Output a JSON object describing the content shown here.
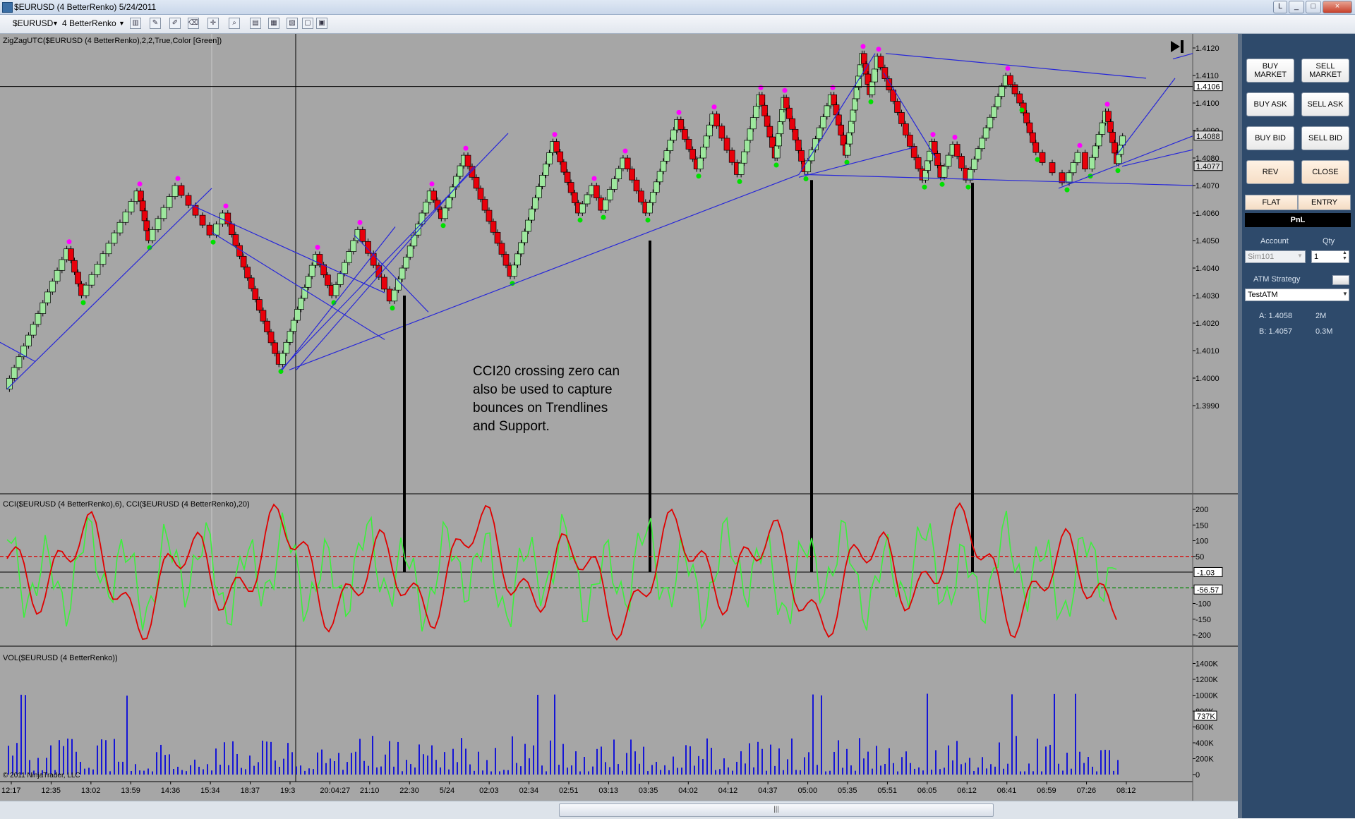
{
  "window": {
    "title": "$EURUSD (4 BetterRenko)  5/24/2011",
    "buttons": [
      "L",
      "_",
      "□",
      "×"
    ]
  },
  "toolbar": {
    "instrument": "$EURUSD",
    "period": "4 BetterRenko"
  },
  "main_panel": {
    "indicator_label": "ZigZagUTC($EURUSD (4 BetterRenko),2,2,True,Color [Green])",
    "y_ticks": [
      "1.4120",
      "1.4110",
      "1.4100",
      "1.4090",
      "1.4080",
      "1.4070",
      "1.4060",
      "1.4050",
      "1.4040",
      "1.4030",
      "1.4020",
      "1.4010",
      "1.4000",
      "1.3990"
    ],
    "price_markers": [
      {
        "text": "1.4106",
        "value": 1.4106
      },
      {
        "text": "1.4088",
        "value": 1.4088
      },
      {
        "text": "1.4077",
        "value": 1.4077
      }
    ],
    "end_icon": "skip-to-end-icon"
  },
  "annotation": {
    "lines": [
      "CCI20 crossing zero can",
      "also be used to capture",
      "bounces on Trendlines",
      "and Support."
    ]
  },
  "cci_panel": {
    "label": "CCI($EURUSD (4 BetterRenko),6), CCI($EURUSD (4 BetterRenko),20)",
    "y_ticks": [
      "200",
      "150",
      "100",
      "50",
      "-50",
      "-100",
      "-150",
      "-200"
    ],
    "current_markers": [
      {
        "text": "-1.03",
        "value": -1.03
      },
      {
        "text": "-56.57",
        "value": -56.57
      }
    ],
    "levels": [
      50,
      -50
    ]
  },
  "volume_panel": {
    "label": "VOL($EURUSD (4 BetterRenko))",
    "y_ticks": [
      "1400K",
      "1200K",
      "1000K",
      "800K",
      "600K",
      "400K",
      "200K",
      "0"
    ],
    "current_marker": {
      "text": "737K",
      "value": 737
    },
    "copyright": "© 2011 NinjaTrader, LLC"
  },
  "x_axis": {
    "labels": [
      "12:17",
      "12:35",
      "13:02",
      "13:59",
      "14:36",
      "15:34",
      "18:37",
      "19:3",
      "20:04:27",
      "21:10",
      "22:30",
      "5/24",
      "02:03",
      "02:34",
      "02:51",
      "03:13",
      "03:35",
      "04:02",
      "04:12",
      "04:37",
      "05:00",
      "05:35",
      "05:51",
      "06:05",
      "06:12",
      "06:41",
      "06:59",
      "07:26",
      "08:12"
    ]
  },
  "scrollbar": {
    "grip": "|||"
  },
  "order_panel": {
    "buttons": {
      "buy_market": "BUY MARKET",
      "sell_market": "SELL MARKET",
      "buy_ask": "BUY ASK",
      "sell_ask": "SELL ASK",
      "buy_bid": "BUY BID",
      "sell_bid": "SELL BID",
      "rev": "REV",
      "close": "CLOSE",
      "flat": "FLAT",
      "entry": "ENTRY"
    },
    "pnl": "PnL",
    "account_label": "Account",
    "qty_label": "Qty",
    "account_value": "Sim101",
    "qty_value": "1",
    "atm_label": "ATM Strategy",
    "atm_value": "TestATM",
    "ask_text": "A: 1.4058",
    "ask_size": "2M",
    "bid_text": "B: 1.4057",
    "bid_size": "0.3M"
  },
  "colors": {
    "chart_bg": "#a6a6a6",
    "up_candle": "#9ee89e",
    "down_candle": "#e8000b",
    "trendline": "#2626d9",
    "cci6": "#3cf03c",
    "cci20": "#e00000",
    "volume": "#1515d6",
    "swing_high": "#ff00ff",
    "swing_low": "#00e000"
  }
}
